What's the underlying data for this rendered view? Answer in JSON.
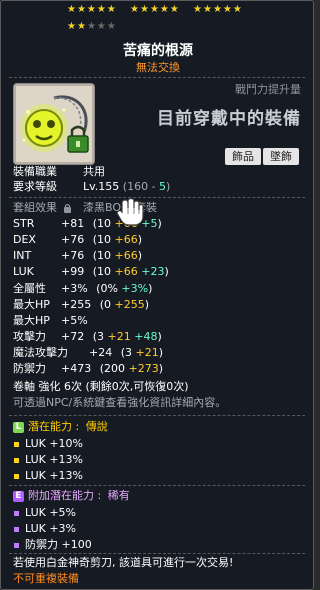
{
  "stars": {
    "groups_filled": [
      "★★★★★",
      "★★★★★",
      "★★★★★",
      "★★"
    ],
    "groups_empty": [
      "",
      "",
      "",
      "★★★"
    ]
  },
  "item": {
    "name": "苦痛的根源",
    "trade_status": "無法交換"
  },
  "compare": {
    "small": "戰鬥力提升量",
    "big": "目前穿戴中的裝備"
  },
  "tags": [
    "飾品",
    "墜飾"
  ],
  "requirements": {
    "job_label": "裝備職業",
    "job_value": "共用",
    "level_label": "要求等級",
    "level_value": "Lv.155",
    "level_detail_open": "(160 - ",
    "level_detail_bonus": "5",
    "level_detail_close": ")"
  },
  "set": {
    "label": "套組效果",
    "name": "漆黑BOSS套裝"
  },
  "stats": [
    {
      "k": "STR",
      "total": "+81",
      "base": "(10",
      "bonus1": "+66",
      "bonus2": "+5",
      "close": ")"
    },
    {
      "k": "DEX",
      "total": "+76",
      "base": "(10",
      "bonus1": "+66",
      "bonus2": "",
      "close": ")"
    },
    {
      "k": "INT",
      "total": "+76",
      "base": "(10",
      "bonus1": "+66",
      "bonus2": "",
      "close": ")"
    },
    {
      "k": "LUK",
      "total": "+99",
      "base": "(10",
      "bonus1": "+66",
      "bonus2": "+23",
      "close": ")"
    }
  ],
  "stats2": [
    {
      "k": "全屬性",
      "total": "+3%",
      "base": "(0%",
      "bonus1": "",
      "bonus2": "+3%",
      "close": ")"
    },
    {
      "k": "最大HP",
      "total": "+255",
      "base": "(0",
      "bonus1": "+255",
      "bonus2": "",
      "close": ")"
    },
    {
      "k": "最大HP",
      "total": "+5%",
      "base": "",
      "bonus1": "",
      "bonus2": "",
      "close": ""
    },
    {
      "k": "攻擊力",
      "total": "+72",
      "base": "(3",
      "bonus1": "+21",
      "bonus2": "+48",
      "close": ")"
    },
    {
      "k": "魔法攻擊力",
      "total": "+24",
      "base": "(3",
      "bonus1": "+21",
      "bonus2": "",
      "close": ")"
    },
    {
      "k": "防禦力",
      "total": "+473",
      "base": "(200",
      "bonus1": "+273",
      "bonus2": "",
      "close": ")"
    }
  ],
  "scroll": {
    "line": "卷軸 強化 6次 (剩餘0次,可恢復0次)",
    "hint": "可透過NPC/系統鍵查看強化資訊詳細內容。"
  },
  "potential": {
    "badge": "L",
    "label": "潛在能力 :",
    "grade": "傳說",
    "lines": [
      "LUK +10%",
      "LUK +13%",
      "LUK +13%"
    ]
  },
  "additional": {
    "badge": "E",
    "label": "附加潛在能力 :",
    "grade": "稀有",
    "lines": [
      "LUK +5%",
      "LUK +3%",
      "防禦力 +100"
    ]
  },
  "footer": {
    "note": "若使用白金神奇剪刀, 該道具可進行一次交易!",
    "warning": "不可重複裝備"
  },
  "colors": {
    "legendary": "#7ed957",
    "epic": "#b05cff",
    "bonus_yellow": "#ffcc33",
    "bonus_cyan": "#66ffcc",
    "warning": "#ff8a1e"
  }
}
